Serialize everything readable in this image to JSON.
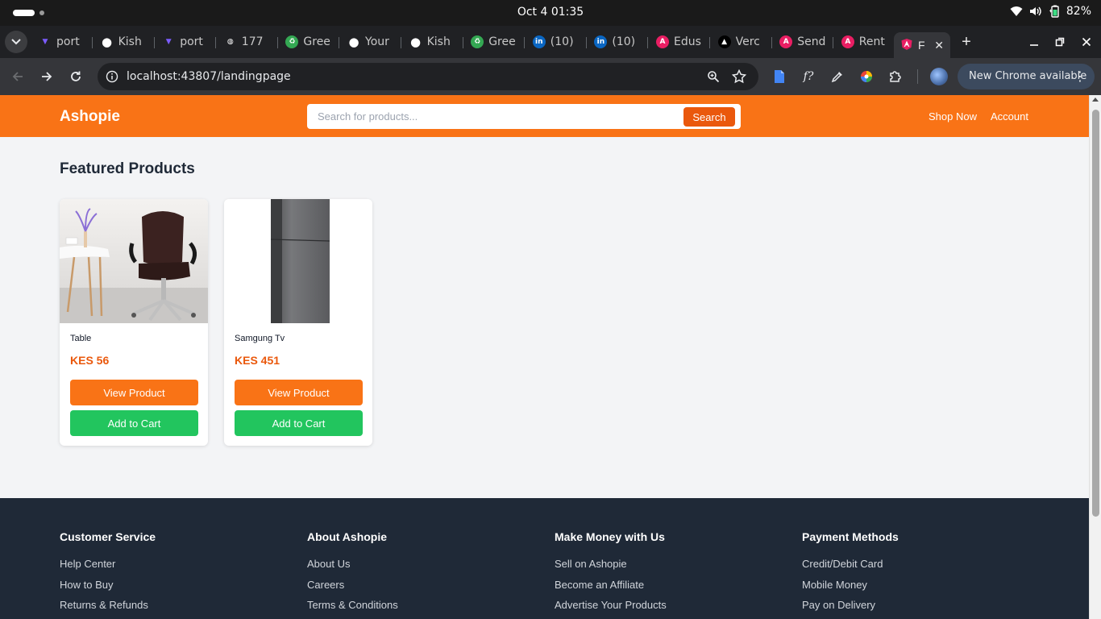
{
  "os": {
    "clock": "Oct 4  01:35",
    "battery": "82%"
  },
  "browser": {
    "tabs": [
      {
        "title": "port",
        "icon": "vite-icon",
        "color": "#7c5cff"
      },
      {
        "title": "Kish",
        "icon": "github-icon",
        "color": "#ffffff"
      },
      {
        "title": "port",
        "icon": "vite-icon",
        "color": "#7c5cff"
      },
      {
        "title": "177",
        "icon": "globe-icon",
        "color": "#9aa0a6"
      },
      {
        "title": "Gree",
        "icon": "recycle-icon",
        "color": "#34a853"
      },
      {
        "title": "Your",
        "icon": "github-icon",
        "color": "#ffffff"
      },
      {
        "title": "Kish",
        "icon": "github-icon",
        "color": "#ffffff"
      },
      {
        "title": "Gree",
        "icon": "recycle-icon",
        "color": "#34a853"
      },
      {
        "title": "(10)",
        "icon": "linkedin-icon",
        "color": "#0a66c2"
      },
      {
        "title": "(10)",
        "icon": "linkedin-icon",
        "color": "#0a66c2"
      },
      {
        "title": "Edus",
        "icon": "angular-icon",
        "color": "#c3002f"
      },
      {
        "title": "Verc",
        "icon": "vercel-icon",
        "color": "#000000"
      },
      {
        "title": "Send",
        "icon": "angular-icon",
        "color": "#c3002f"
      },
      {
        "title": "Rent",
        "icon": "angular-icon",
        "color": "#c3002f"
      }
    ],
    "active_tab": {
      "title": "F",
      "icon": "angular-icon"
    },
    "url": "localhost:43807/landingpage",
    "update_label": "New Chrome available"
  },
  "site": {
    "brand": "Ashopie",
    "search": {
      "placeholder": "Search for products...",
      "button": "Search"
    },
    "nav": {
      "shop_now": "Shop Now",
      "account": "Account"
    },
    "featured_title": "Featured Products",
    "products": [
      {
        "name": "Table",
        "price": "KES 56",
        "view_label": "View Product",
        "cart_label": "Add to Cart",
        "image": "office-chair-photo"
      },
      {
        "name": "Samgung Tv",
        "price": "KES 451",
        "view_label": "View Product",
        "cart_label": "Add to Cart",
        "image": "refrigerator-photo"
      }
    ],
    "footer": [
      {
        "heading": "Customer Service",
        "links": [
          "Help Center",
          "How to Buy",
          "Returns & Refunds"
        ]
      },
      {
        "heading": "About Ashopie",
        "links": [
          "About Us",
          "Careers",
          "Terms & Conditions"
        ]
      },
      {
        "heading": "Make Money with Us",
        "links": [
          "Sell on Ashopie",
          "Become an Affiliate",
          "Advertise Your Products"
        ]
      },
      {
        "heading": "Payment Methods",
        "links": [
          "Credit/Debit Card",
          "Mobile Money",
          "Pay on Delivery"
        ]
      }
    ]
  },
  "colors": {
    "brand_orange": "#f97316",
    "button_orange": "#ea580c",
    "cart_green": "#22c55e",
    "footer_bg": "#1f2937"
  }
}
